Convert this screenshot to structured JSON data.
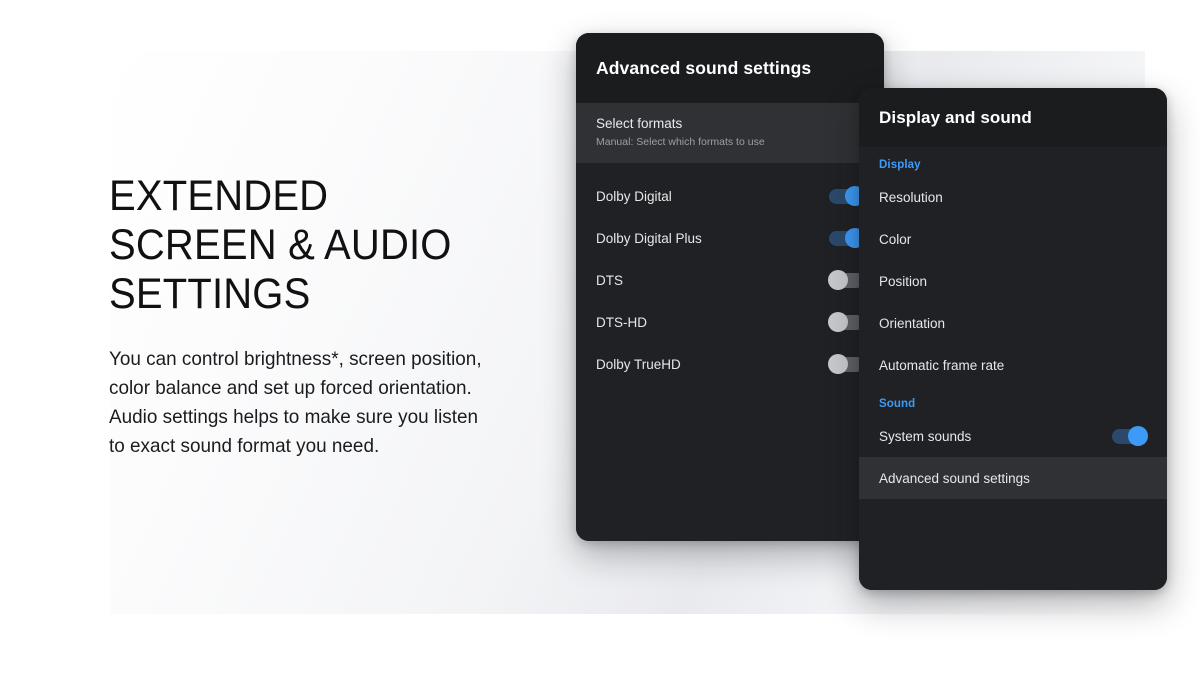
{
  "promo": {
    "headline": "EXTENDED\nSCREEN & AUDIO\nSETTINGS",
    "body": "You can control brightness*, screen position,\ncolor balance and set up forced orientation.\nAudio settings helps to make sure you listen\nto exact sound format you need."
  },
  "colors": {
    "accent_blue": "#3d9bf7",
    "toggle_on_track": "#2b4a6b",
    "toggle_off_track": "#5f6368",
    "toggle_off_knob": "#c7c9cc",
    "panel_bg": "#202124",
    "panel_header_bg": "#1b1c1e",
    "row_selected_bg": "#303134",
    "text_primary": "#e6e7e9",
    "text_secondary": "#9aa0a6"
  },
  "advanced_sound_panel": {
    "title": "Advanced sound settings",
    "select_formats": {
      "title": "Select formats",
      "subtitle": "Manual: Select which formats to use"
    },
    "formats": [
      {
        "label": "Dolby Digital",
        "state": "on"
      },
      {
        "label": "Dolby Digital Plus",
        "state": "on"
      },
      {
        "label": "DTS",
        "state": "off"
      },
      {
        "label": "DTS-HD",
        "state": "off"
      },
      {
        "label": "Dolby TrueHD",
        "state": "off"
      }
    ]
  },
  "display_sound_panel": {
    "title": "Display and sound",
    "sections": [
      {
        "label": "Display",
        "items": [
          {
            "label": "Resolution"
          },
          {
            "label": "Color"
          },
          {
            "label": "Position"
          },
          {
            "label": "Orientation"
          },
          {
            "label": "Automatic frame rate"
          }
        ]
      },
      {
        "label": "Sound",
        "items": [
          {
            "label": "System sounds",
            "toggle": "on"
          },
          {
            "label": "Advanced sound settings",
            "selected": true
          }
        ]
      }
    ]
  }
}
